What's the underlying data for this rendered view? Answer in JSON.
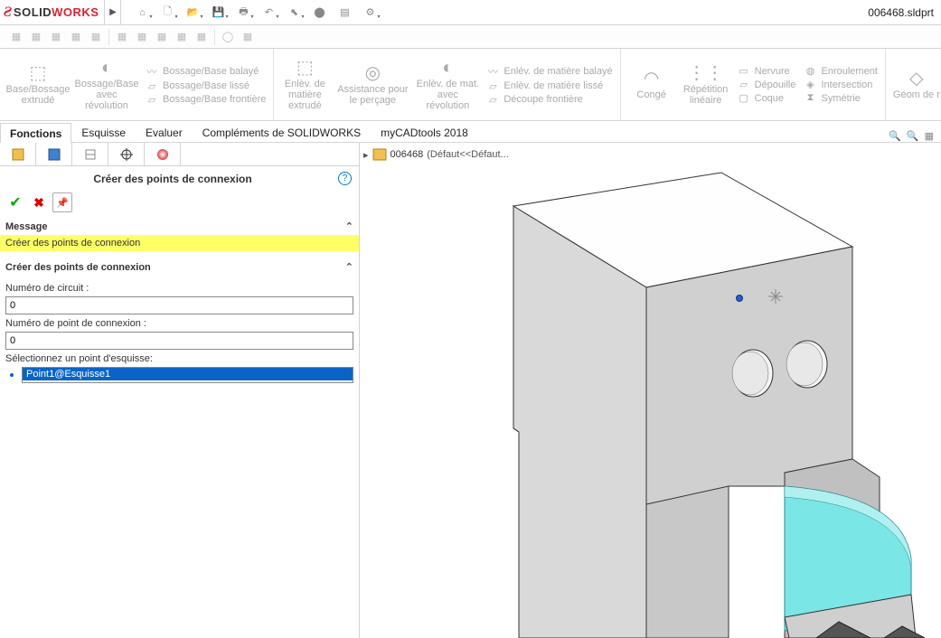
{
  "app": {
    "brand_solid": "SOLID",
    "brand_works": "WORKS",
    "file_name": "006468.sldprt"
  },
  "ribbon": {
    "group1": {
      "extrude": "Base/Bossage extrudé",
      "revolve": "Bossage/Base avec révolution"
    },
    "bossage_stack": {
      "swept": "Bossage/Base balayé",
      "lofted": "Bossage/Base lissé",
      "boundary": "Bossage/Base frontière"
    },
    "cut": {
      "extrude": "Enlèv. de matière extrudé",
      "hole": "Assistance pour le perçage",
      "revolve": "Enlèv. de mat. avec révolution"
    },
    "cut_stack": {
      "swept": "Enlèv. de matière balayé",
      "lofted": "Enlèv. de matière lissé",
      "boundary": "Découpe frontière"
    },
    "features": {
      "fillet": "Congé",
      "pattern": "Répétition linéaire"
    },
    "feat_stack": {
      "rib": "Nervure",
      "draft": "Dépouille",
      "shell": "Coque"
    },
    "feat_stack2": {
      "wrap": "Enroulement",
      "intersect": "Intersection",
      "mirror": "Symétrie"
    },
    "geom": "Géom de r"
  },
  "tabs": {
    "t1": "Fonctions",
    "t2": "Esquisse",
    "t3": "Evaluer",
    "t4": "Compléments de SOLIDWORKS",
    "t5": "myCADtools 2018"
  },
  "vp_tree": {
    "part": "006468",
    "config": "(Défaut<<Défaut..."
  },
  "pm": {
    "title": "Créer des points de connexion",
    "section_message": "Message",
    "message_text": "Créer des points de connexion",
    "section_create": "Créer des points de connexion",
    "label_circuit": "Numéro de circuit :",
    "val_circuit": "0",
    "label_cpoint": "Numéro de point de connexion :",
    "val_cpoint": "0",
    "label_select": "Sélectionnez un point d'esquisse:",
    "selected": "Point1@Esquisse1"
  }
}
